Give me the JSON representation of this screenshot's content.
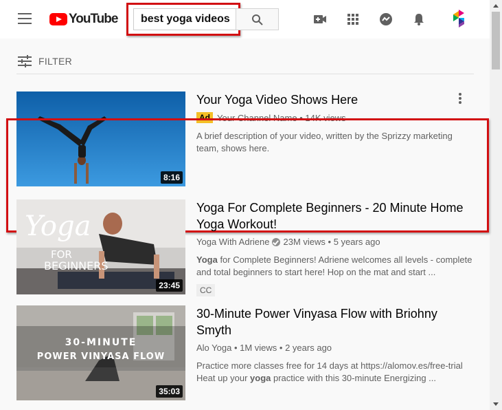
{
  "header": {
    "logo_text": "YouTube",
    "search_value": "best yoga videos"
  },
  "filter": {
    "label": "FILTER"
  },
  "results": [
    {
      "title": "Your Yoga Video Shows Here",
      "is_ad": true,
      "ad_label": "Ad",
      "channel": "Your Channel Name",
      "views": "14K views",
      "desc": "A brief description of your video, written by the Sprizzy marketing team, shows here.",
      "duration": "8:16"
    },
    {
      "title": "Yoga For Complete Beginners - 20 Minute Home Yoga Workout!",
      "channel": "Yoga With Adriene",
      "views": "23M views",
      "age": "5 years ago",
      "desc_bold": "Yoga",
      "desc_rest": " for Complete Beginners! Adriene welcomes all levels - complete and total beginners to start here! Hop on the mat and start ...",
      "badge": "CC",
      "duration": "23:45",
      "thumb_text_line1": "Yoga",
      "thumb_text_line2": "FOR",
      "thumb_text_line3": "BEGINNERS"
    },
    {
      "title": "30-Minute Power Vinyasa Flow with Briohny Smyth",
      "channel": "Alo Yoga",
      "views": "1M views",
      "age": "2 years ago",
      "desc_line1": "Practice more classes free for 14 days at https://alomov.es/free-trial",
      "desc_line2_pre": "Heat up your ",
      "desc_line2_bold": "yoga",
      "desc_line2_post": " practice with this 30-minute Energizing ...",
      "duration": "35:03",
      "thumb_text_line1": "30-MINUTE",
      "thumb_text_line2": "POWER VINYASA FLOW"
    }
  ],
  "colors": {
    "brand_red": "#ff0000",
    "highlight_red": "#d20f12",
    "ad_yellow": "#f4bf26"
  }
}
